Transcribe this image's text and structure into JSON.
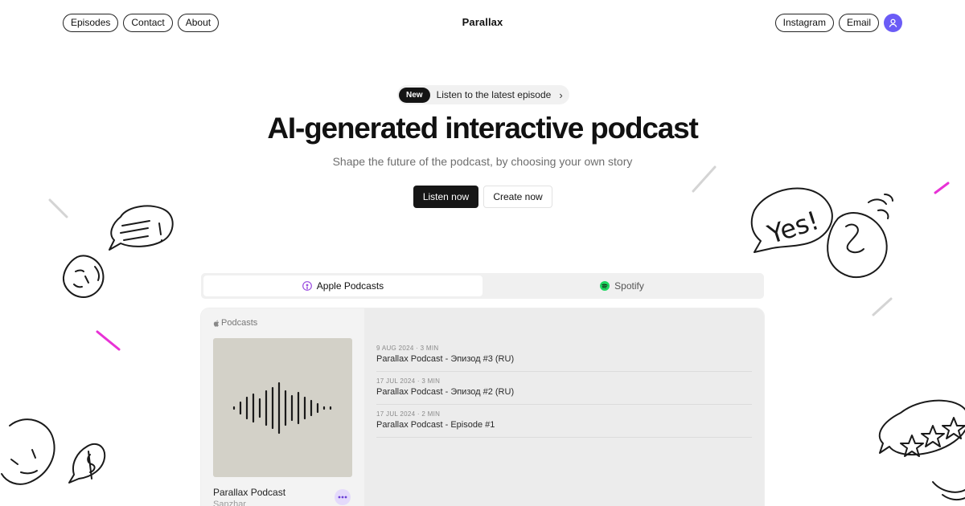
{
  "nav": {
    "left": [
      "Episodes",
      "Contact",
      "About"
    ],
    "brand": "Parallax",
    "right": [
      "Instagram",
      "Email"
    ]
  },
  "announcement": {
    "badge": "New",
    "text": "Listen to the latest episode"
  },
  "hero": {
    "title": "AI-generated interactive podcast",
    "subtitle": "Shape the future of the podcast, by choosing your own story",
    "primary_cta": "Listen now",
    "secondary_cta": "Create now"
  },
  "tabs": [
    {
      "label": "Apple Podcasts",
      "active": true,
      "icon": "apple-podcasts-icon"
    },
    {
      "label": "Spotify",
      "active": false,
      "icon": "spotify-icon"
    }
  ],
  "player": {
    "source_label": "Podcasts",
    "show_name": "Parallax Podcast",
    "author": "Sanzhar",
    "episodes": [
      {
        "meta": "9 AUG 2024 · 3 MIN",
        "title": "Parallax Podcast - Эпизод #3 (RU)"
      },
      {
        "meta": "17 JUL 2024 · 3 MIN",
        "title": "Parallax Podcast - Эпизод #2 (RU)"
      },
      {
        "meta": "17 JUL 2024 · 2 MIN",
        "title": "Parallax Podcast - Episode #1"
      }
    ]
  },
  "doodles": {
    "speech_bubble_text": "Yes!"
  },
  "colors": {
    "accent": "#6b5cf6",
    "doodle_pink": "#e832d6",
    "spotify": "#1ed760",
    "dark": "#161616"
  }
}
